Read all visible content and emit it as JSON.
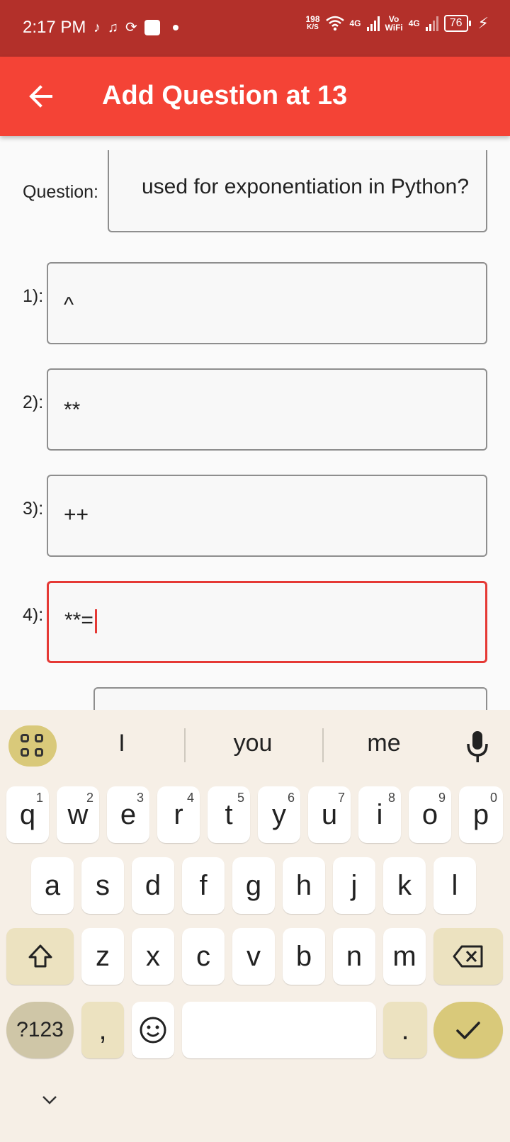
{
  "status_bar": {
    "time": "2:17 PM",
    "net_speed_value": "198",
    "net_speed_unit": "K/S",
    "net1": "4G",
    "volte_top": "Vo",
    "volte_bottom": "WiFi",
    "net2": "4G",
    "battery": "76",
    "icons": [
      "tiktok-icon",
      "music-icon",
      "sync-icon",
      "mail-icon",
      "dot-icon",
      "wifi-icon",
      "signal-icon",
      "charging-icon"
    ]
  },
  "app_bar": {
    "title": "Add Question at 13",
    "back_icon": "arrow-left-icon"
  },
  "form": {
    "question_label": "Question:",
    "question_value": "used for exponentiation in Python?",
    "options": [
      {
        "label": "1):",
        "value": "^"
      },
      {
        "label": "2):",
        "value": "**"
      },
      {
        "label": "3):",
        "value": "++"
      },
      {
        "label": "4):",
        "value": "**="
      }
    ]
  },
  "keyboard": {
    "suggestions": [
      "I",
      "you",
      "me"
    ],
    "row1": [
      {
        "key": "q",
        "hint": "1"
      },
      {
        "key": "w",
        "hint": "2"
      },
      {
        "key": "e",
        "hint": "3"
      },
      {
        "key": "r",
        "hint": "4"
      },
      {
        "key": "t",
        "hint": "5"
      },
      {
        "key": "y",
        "hint": "6"
      },
      {
        "key": "u",
        "hint": "7"
      },
      {
        "key": "i",
        "hint": "8"
      },
      {
        "key": "o",
        "hint": "9"
      },
      {
        "key": "p",
        "hint": "0"
      }
    ],
    "row2": [
      "a",
      "s",
      "d",
      "f",
      "g",
      "h",
      "j",
      "k",
      "l"
    ],
    "row3": [
      "z",
      "x",
      "c",
      "v",
      "b",
      "n",
      "m"
    ],
    "symbols_key": "?123",
    "comma_key": ",",
    "period_key": ".",
    "accent_color": "#d9c97a"
  },
  "colors": {
    "status_bar": "#b3302a",
    "app_bar": "#f44336",
    "focus": "#e53935"
  }
}
